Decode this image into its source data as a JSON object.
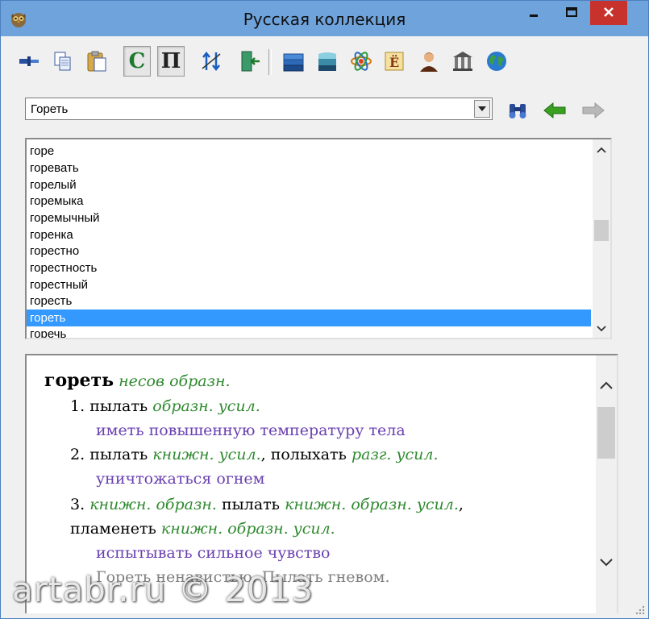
{
  "window": {
    "title": "Русская коллекция"
  },
  "toolbar": {
    "tools": [
      {
        "name": "pin-icon"
      },
      {
        "name": "copy-icon"
      },
      {
        "name": "paste-icon"
      },
      {
        "name": "letter-c-button",
        "letter": "C",
        "color": "#1e7a2e",
        "pressed": true
      },
      {
        "name": "letter-p-button",
        "letter": "П",
        "color": "#222222",
        "pressed": true
      },
      {
        "name": "sort-arrows-icon"
      },
      {
        "name": "exit-door-icon"
      },
      {
        "name": "blue-books-icon"
      },
      {
        "name": "teal-books-icon"
      },
      {
        "name": "atom-icon"
      },
      {
        "name": "letter-ye-book-icon"
      },
      {
        "name": "portrait-icon"
      },
      {
        "name": "library-icon"
      },
      {
        "name": "globe-icon"
      }
    ]
  },
  "search": {
    "value": "Гореть"
  },
  "word_list": {
    "items": [
      "горе",
      "горевать",
      "горелый",
      "горемыка",
      "горемычный",
      "горенка",
      "горестно",
      "горестность",
      "горестный",
      "горесть",
      "гореть",
      "горечь"
    ],
    "selected_index": 10
  },
  "article": {
    "headword": "гореть",
    "headword_labels": "несов образн.",
    "senses": {
      "s1_num": "1.",
      "s1_word": "пылать",
      "s1_labels": "образн. усил.",
      "s1_def": "иметь повышенную температуру тела",
      "s2_num": "2.",
      "s2_word1": "пылать",
      "s2_labels1": "книжн. усил.",
      "s2_comma": ",",
      "s2_word2": "полыхать",
      "s2_labels2": "разг. усил.",
      "s2_def": "уничтожаться огнем",
      "s3_num": "3.",
      "s3_labels1": "книжн. образн.",
      "s3_word1": "пылать",
      "s3_labels2": "книжн. образн. усил.",
      "s3_comma": ",",
      "s3_word2": "пламенеть",
      "s3_labels3": "книжн. образн. усил.",
      "s3_def": "испытывать сильное чувство",
      "s3_example": "Гореть ненавистью. Пылать гневом."
    }
  },
  "watermark": "artabr.ru © 2013",
  "colors": {
    "titlebar": "#6fa3dc",
    "selection": "#3399ff",
    "label_green": "#2f8a2f",
    "definition_purple": "#6a40b0"
  }
}
